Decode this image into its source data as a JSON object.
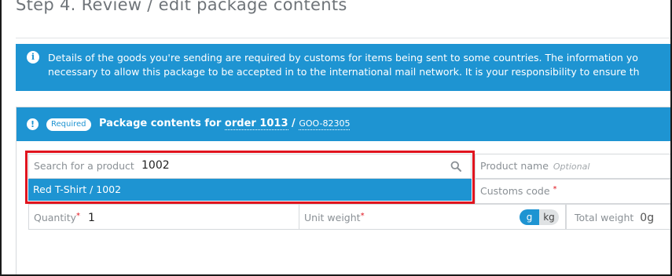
{
  "step_title": "Step 4. Review / edit package contents",
  "info_banner": {
    "line1": "Details of the goods you're sending are required by customs for items being sent to some countries. The information yo",
    "line2": "necessary to allow this package to be accepted in to the international mail network. It is your responsibility to ensure th"
  },
  "package": {
    "required_badge": "Required",
    "title_prefix": "Package contents for",
    "order_label": "order 1013",
    "separator": "/",
    "reference": "GOO-82305"
  },
  "search": {
    "label": "Search for a product",
    "value": "1002",
    "results": [
      "Red T-Shirt / 1002"
    ]
  },
  "fields": {
    "product_name": {
      "label": "Product name",
      "hint": "Optional"
    },
    "customs_code": {
      "label": "Customs code",
      "required_mark": "*"
    },
    "quantity": {
      "label": "Quantity",
      "required_mark": "*",
      "value": "1"
    },
    "unit_weight": {
      "label": "Unit weight",
      "required_mark": "*",
      "units": [
        "g",
        "kg"
      ],
      "selected_unit": "g"
    },
    "total_weight": {
      "label": "Total weight",
      "value": "0g"
    }
  },
  "colors": {
    "accent": "#1e94d2",
    "highlight_outline": "#e0141e",
    "required": "#e0141e"
  }
}
